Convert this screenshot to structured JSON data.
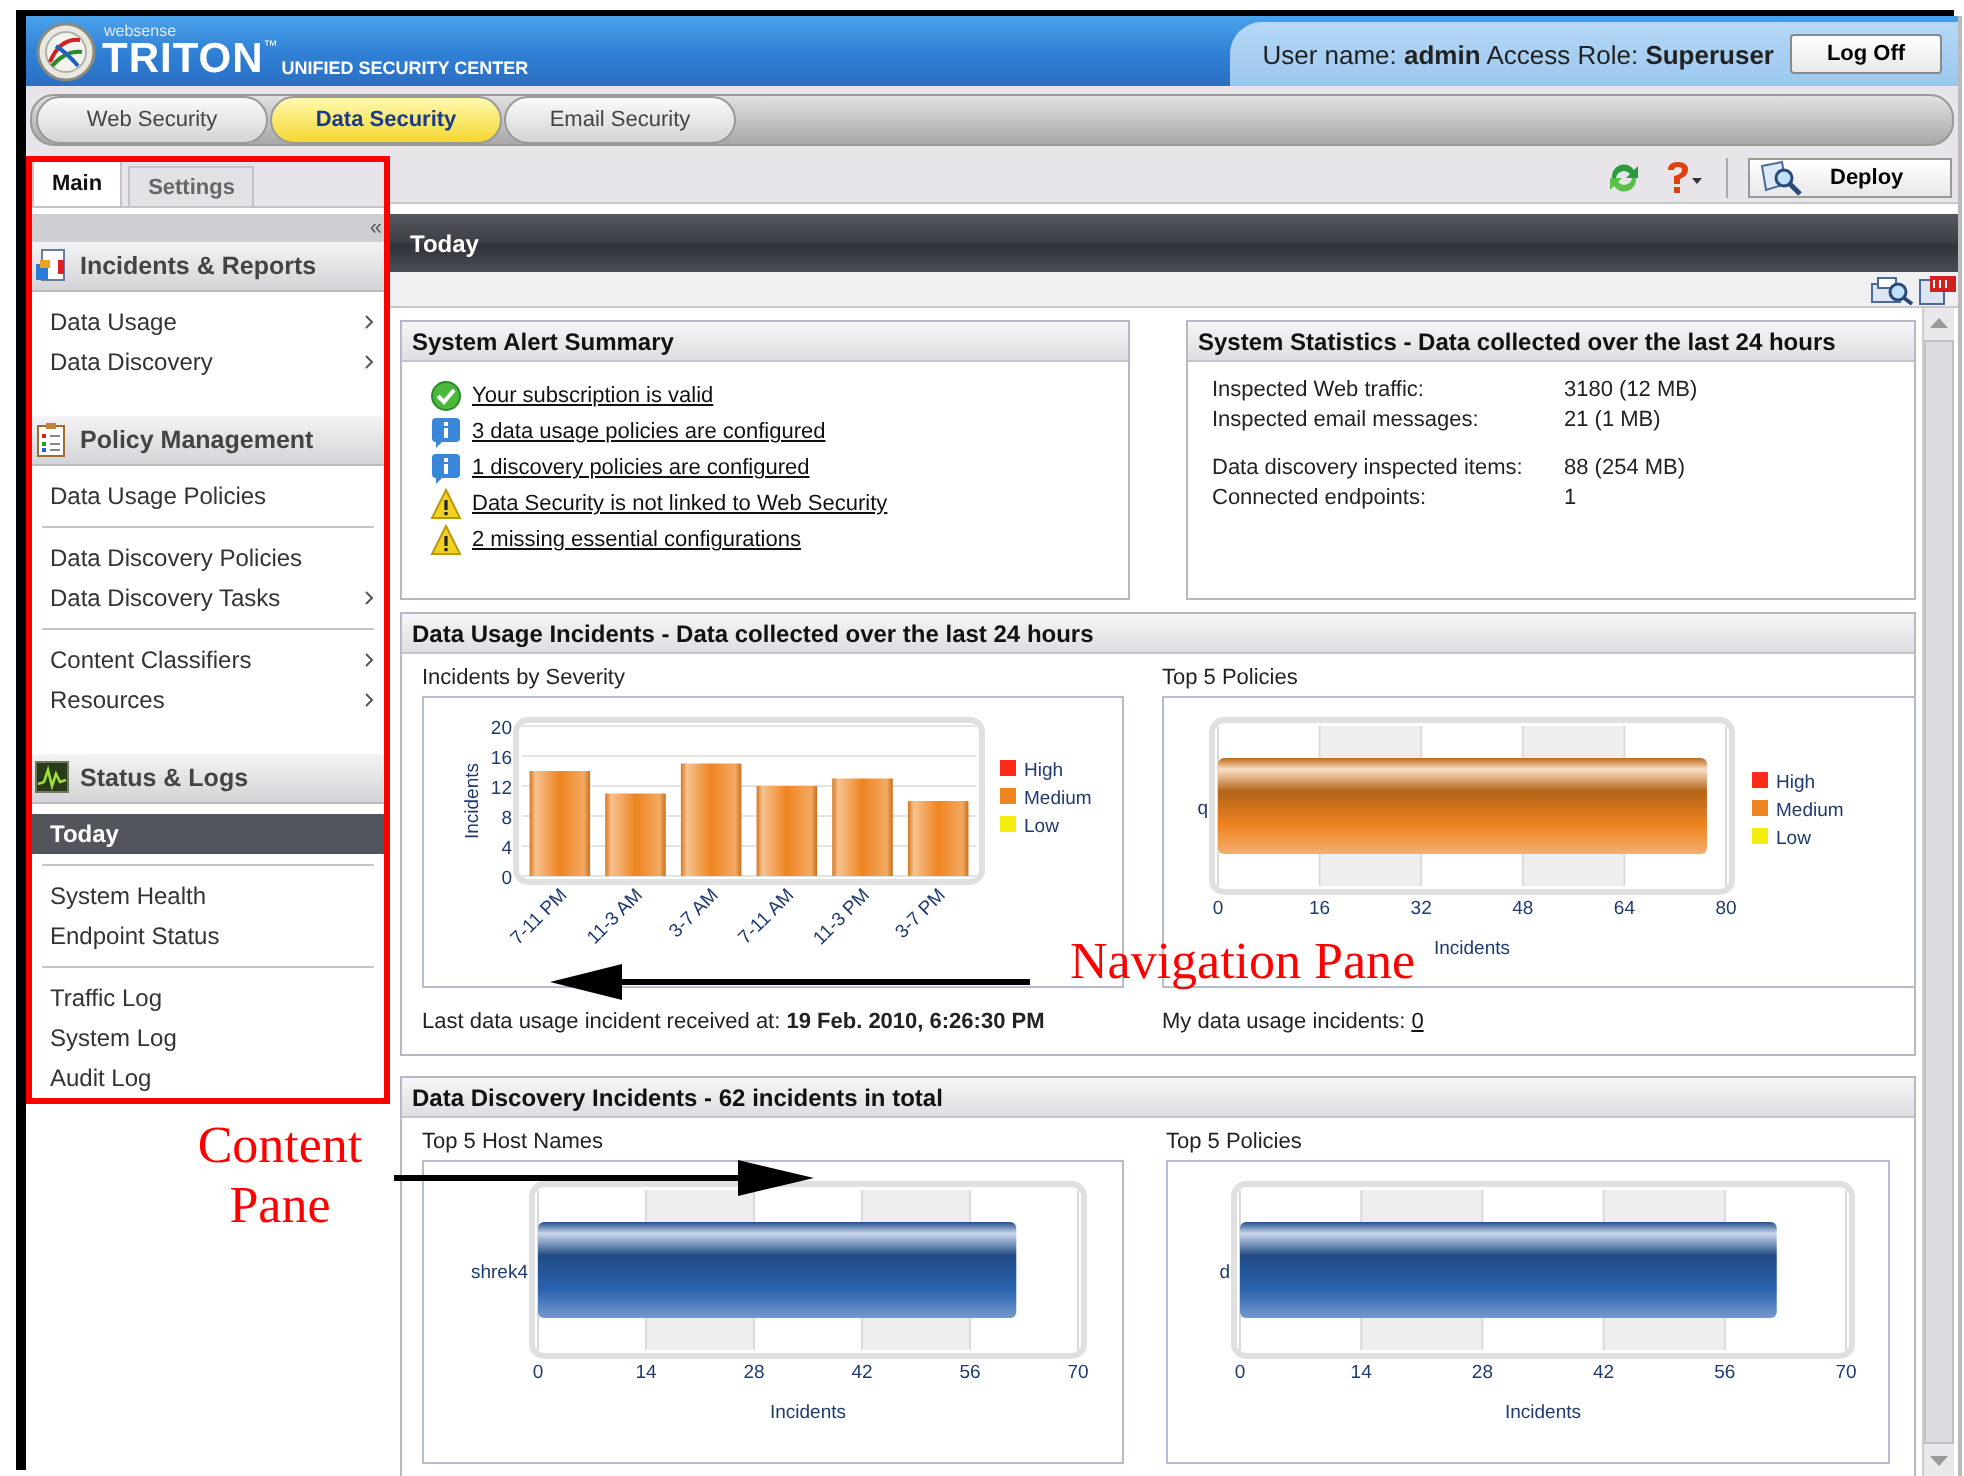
{
  "header": {
    "brand_small": "websense",
    "brand": "TRITON",
    "trademark": "™",
    "subtitle": "UNIFIED SECURITY CENTER",
    "user_info": "User name: **admin**  Access Role: **Superuser**",
    "logoff": "Log Off"
  },
  "product_tabs": [
    {
      "label": "Web Security",
      "selected": false
    },
    {
      "label": "Data Security",
      "selected": true
    },
    {
      "label": "Email Security",
      "selected": false
    }
  ],
  "sidebar": {
    "tabs": [
      {
        "label": "Main",
        "selected": true
      },
      {
        "label": "Settings",
        "selected": false
      }
    ],
    "collapse": "«",
    "sections": [
      {
        "title": "Incidents & Reports",
        "groups": [
          [
            {
              "label": "Data Usage",
              "submenu": true,
              "selected": false
            },
            {
              "label": "Data Discovery",
              "submenu": true,
              "selected": false
            }
          ]
        ]
      },
      {
        "title": "Policy Management",
        "groups": [
          [
            {
              "label": "Data Usage Policies",
              "submenu": false,
              "selected": false
            }
          ],
          [
            {
              "label": "Data Discovery Policies",
              "submenu": false,
              "selected": false
            },
            {
              "label": "Data Discovery Tasks",
              "submenu": true,
              "selected": false
            }
          ],
          [
            {
              "label": "Content Classifiers",
              "submenu": true,
              "selected": false
            },
            {
              "label": "Resources",
              "submenu": true,
              "selected": false
            }
          ]
        ]
      },
      {
        "title": "Status & Logs",
        "groups": [
          [
            {
              "label": "Today",
              "submenu": false,
              "selected": true
            }
          ],
          [
            {
              "label": "System Health",
              "submenu": false,
              "selected": false
            },
            {
              "label": "Endpoint Status",
              "submenu": false,
              "selected": false
            }
          ],
          [
            {
              "label": "Traffic Log",
              "submenu": false,
              "selected": false
            },
            {
              "label": "System Log",
              "submenu": false,
              "selected": false
            },
            {
              "label": "Audit Log",
              "submenu": false,
              "selected": false
            }
          ]
        ]
      }
    ]
  },
  "toolbar": {
    "deploy": "Deploy"
  },
  "page_title": "Today",
  "alert_summary": {
    "title": "System Alert Summary",
    "items": [
      {
        "kind": "ok",
        "text": "Your subscription is valid"
      },
      {
        "kind": "info",
        "text": "3 data usage policies are configured"
      },
      {
        "kind": "info",
        "text": "1 discovery policies are configured"
      },
      {
        "kind": "warning",
        "text": "Data Security is not linked to Web Security"
      },
      {
        "kind": "warning",
        "text": "2 missing essential configurations"
      }
    ]
  },
  "system_statistics": {
    "title": "System Statistics - Data collected over the last 24 hours",
    "groups": [
      [
        {
          "label": "Inspected Web traffic:",
          "value": "3180 (12 MB)"
        },
        {
          "label": "Inspected email messages:",
          "value": "21 (1 MB)"
        }
      ],
      [
        {
          "label": "Data discovery inspected items:",
          "value": "88 (254 MB)"
        },
        {
          "label": "Connected endpoints:",
          "value": "1"
        }
      ]
    ]
  },
  "data_usage": {
    "title": "Data Usage Incidents - Data collected over the last 24 hours",
    "severity_title": "Incidents by Severity",
    "severity_chart": {
      "chart_data": {
        "type": "bar",
        "ylabel": "Incidents",
        "categories": [
          "7-11 PM",
          "11-3 AM",
          "3-7 AM",
          "7-11 AM",
          "11-3 PM",
          "3-7 PM"
        ],
        "grid": true,
        "ylim": [
          0,
          20
        ],
        "yticks": [
          0,
          4,
          8,
          12,
          16,
          20
        ],
        "series": [
          {
            "name": "High",
            "color": "#ff2a1a",
            "values": [
              0,
              0,
              0,
              0,
              0,
              0
            ]
          },
          {
            "name": "Medium",
            "color": "#ee8420",
            "values": [
              14,
              11,
              15,
              12,
              13,
              10
            ]
          },
          {
            "name": "Low",
            "color": "#f4ee10",
            "values": [
              0,
              0,
              0,
              0,
              0,
              0
            ]
          }
        ]
      }
    },
    "policies_title": "Top 5 Policies",
    "policies_chart": {
      "chart_data": {
        "type": "bar",
        "orientation": "horizontal",
        "xlabel": "Incidents",
        "categories": [
          "q"
        ],
        "grid": true,
        "xlim": [
          0,
          80
        ],
        "xticks": [
          0,
          16,
          32,
          48,
          64,
          80
        ],
        "series": [
          {
            "name": "High",
            "color": "#ff2a1a",
            "values": [
              0
            ]
          },
          {
            "name": "Medium",
            "color": "#ee8420",
            "values": [
              77
            ]
          },
          {
            "name": "Low",
            "color": "#f4ee10",
            "values": [
              0
            ]
          }
        ]
      }
    },
    "last_incident": "Last data usage incident received at: **19 Feb. 2010, 6:26:30 PM**",
    "my_incidents_label": "My data usage incidents:",
    "my_incidents_value": "0"
  },
  "data_discovery": {
    "title": "Data Discovery Incidents - 62 incidents in total",
    "hosts_title": "Top 5 Host Names",
    "hosts_chart": {
      "chart_data": {
        "type": "bar",
        "orientation": "horizontal",
        "xlabel": "Incidents",
        "categories": [
          "shrek4"
        ],
        "grid": true,
        "xlim": [
          0,
          70
        ],
        "xticks": [
          0,
          14,
          28,
          42,
          56,
          70
        ],
        "series": [
          {
            "color": "#2a62b0",
            "values": [
              62
            ]
          }
        ]
      }
    },
    "policies_title": "Top 5 Policies",
    "policies_chart": {
      "chart_data": {
        "type": "bar",
        "orientation": "horizontal",
        "xlabel": "Incidents",
        "categories": [
          "d"
        ],
        "grid": true,
        "xlim": [
          0,
          70
        ],
        "xticks": [
          0,
          14,
          28,
          42,
          56,
          70
        ],
        "series": [
          {
            "color": "#2a62b0",
            "values": [
              62
            ]
          }
        ]
      }
    }
  },
  "annotations": {
    "navigation_label": "Navigation Pane",
    "content_label": "Content Pane"
  }
}
